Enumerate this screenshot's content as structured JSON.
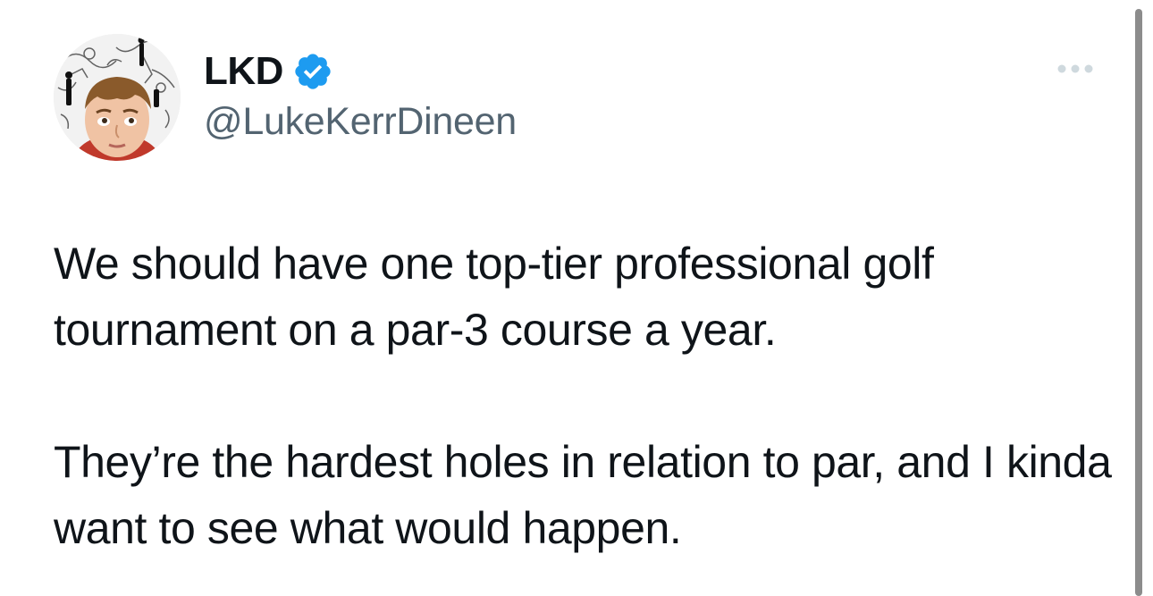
{
  "author": {
    "display_name": "LKD",
    "handle": "@LukeKerrDineen",
    "verified": true,
    "avatar_icon": "profile-photo"
  },
  "tweet": {
    "paragraphs": [
      "We should have one top-tier professional golf tournament on a par-3 course a year.",
      "They’re the hardest holes in relation to par, and I kinda want to see what would happen."
    ]
  },
  "icons": {
    "verified": "verified-badge-icon",
    "more": "more-options-icon"
  },
  "colors": {
    "verified_blue": "#1d9bf0",
    "text_primary": "#0f1419",
    "text_secondary": "#536471",
    "more_icon": "#cfd9de"
  }
}
